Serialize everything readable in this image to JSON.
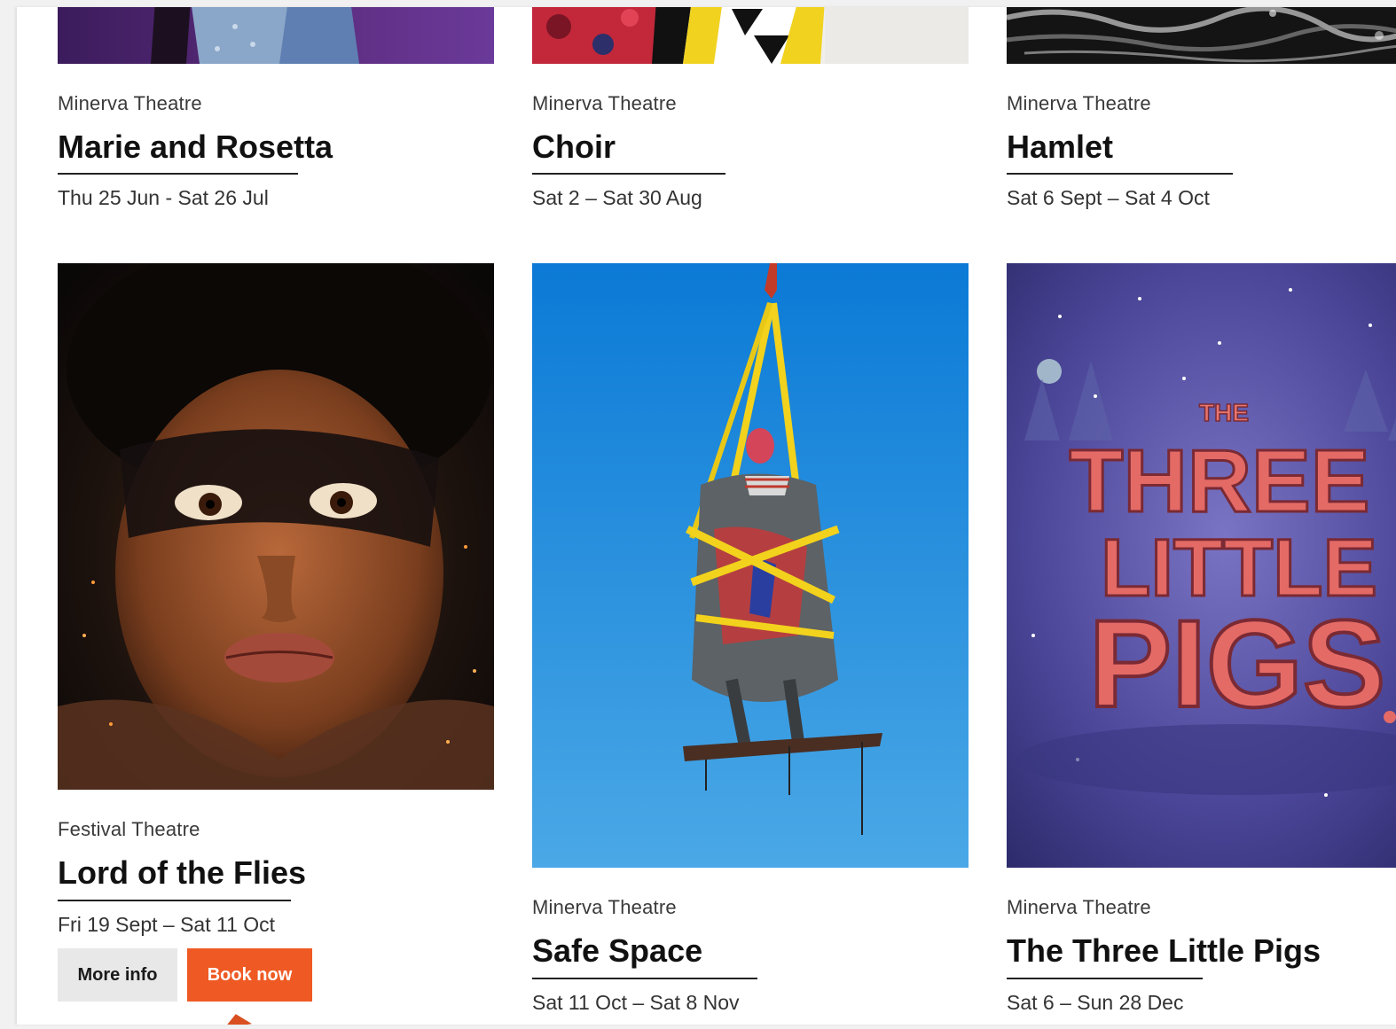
{
  "colors": {
    "accent": "#ef5a24",
    "button_secondary": "#e8e8e8",
    "text": "#111111"
  },
  "shows": [
    {
      "venue": "Minerva Theatre",
      "title": "Marie and Rosetta",
      "dates": "Thu 25 Jun - Sat 26 Jul",
      "image": "marie-and-rosetta-image"
    },
    {
      "venue": "Minerva Theatre",
      "title": "Choir",
      "dates": "Sat 2 – Sat 30 Aug",
      "image": "choir-image"
    },
    {
      "venue": "Minerva Theatre",
      "title": "Hamlet",
      "dates": "Sat 6 Sept – Sat 4 Oct",
      "image": "hamlet-image"
    },
    {
      "venue": "Festival Theatre",
      "title": "Lord of the Flies",
      "dates": "Fri 19 Sept – Sat 11 Oct",
      "image": "lord-of-the-flies-image",
      "buttons": {
        "more_info": "More info",
        "book_now": "Book now"
      }
    },
    {
      "venue": "Minerva Theatre",
      "title": "Safe Space",
      "dates": "Sat 11 Oct – Sat 8 Nov",
      "image": "safe-space-image"
    },
    {
      "venue": "Minerva Theatre",
      "title": "The Three Little Pigs",
      "dates": "Sat 6 – Sun 28 Dec",
      "image": "three-little-pigs-image",
      "poster_text": [
        "THE",
        "THREE",
        "LITTLE",
        "PIGS"
      ]
    }
  ]
}
